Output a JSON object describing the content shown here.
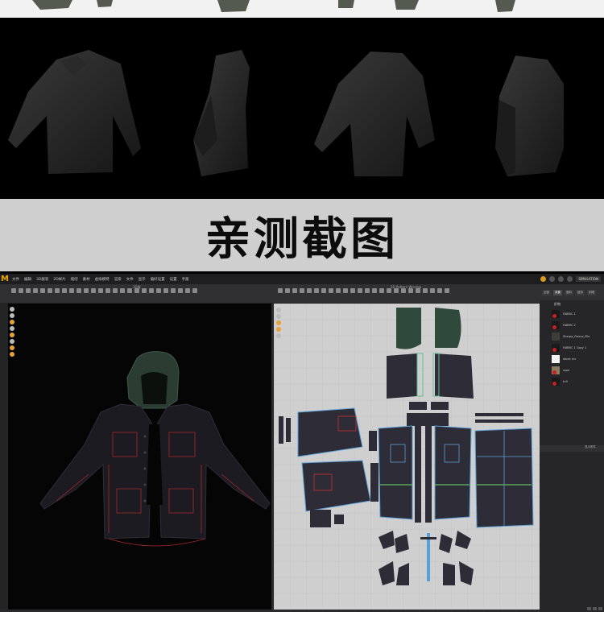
{
  "caption": "亲测截图",
  "app": {
    "menu": [
      "文件",
      "编辑",
      "3D服装",
      "2D样片",
      "缝纫",
      "素材",
      "虚拟模特",
      "渲染",
      "文件",
      "显示",
      "偏好设置",
      "设置",
      "手册"
    ],
    "sim_status": "SIMULATION",
    "view3d_title": "3D服",
    "view2d_title": "2D Pattern Window",
    "right_tabs": [
      "全部",
      "对象",
      "面料",
      "纽扣",
      "扣眼"
    ],
    "right_subheader": "织物",
    "fabrics": [
      {
        "name": "FABRIC 1",
        "color": "#1a1a1a"
      },
      {
        "name": "FABRIC 2",
        "color": "#1a1a1a"
      },
      {
        "name": "Sherpa_Fleece_Pile",
        "color": "#3a3f38"
      },
      {
        "name": "FABRIC 1 Copy 1",
        "color": "#1a1a1a"
      },
      {
        "name": "fabric mc",
        "color": "#f4f4f4"
      },
      {
        "name": "rope",
        "color": "#8a7a60"
      },
      {
        "name": "trill",
        "color": "#1a1a1a"
      }
    ],
    "right_bottom_label": "显示附件",
    "colors": {
      "accent": "#f0a500",
      "pattern_body": "#2e2c36",
      "pattern_hood": "#2f4a3c",
      "pattern_outline": "#5aa0d8",
      "stitch": "#c83030"
    }
  }
}
